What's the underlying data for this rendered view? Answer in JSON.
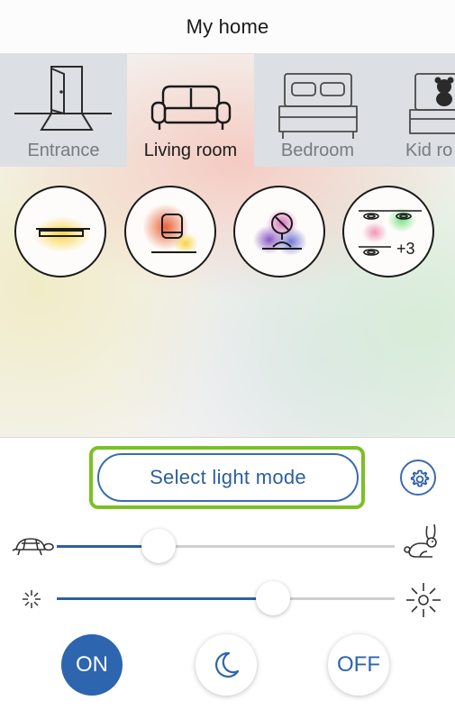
{
  "header": {
    "title": "My home"
  },
  "rooms": [
    {
      "label": "Entrance",
      "icon": "door-icon",
      "active": false
    },
    {
      "label": "Living room",
      "icon": "sofa-icon",
      "active": true
    },
    {
      "label": "Bedroom",
      "icon": "bed-icon",
      "active": false
    },
    {
      "label": "Kid ro",
      "icon": "kid-bed-icon",
      "active": false
    }
  ],
  "lamps": [
    {
      "icon": "ceiling-bar-light-icon",
      "glow": "#f5cf3a"
    },
    {
      "icon": "table-lamp-icon",
      "glow": "#e8623a"
    },
    {
      "icon": "desk-lamp-icon",
      "glow": "#8a55c2"
    },
    {
      "icon": "spotlight-group-icon",
      "extra": "+3"
    }
  ],
  "controls": {
    "mode_button_label": "Select light mode",
    "speed_slider": {
      "min_icon": "turtle-icon",
      "max_icon": "rabbit-icon",
      "value": 0.3
    },
    "brightness_slider": {
      "min_icon": "dim-sun-icon",
      "max_icon": "bright-sun-icon",
      "value": 0.64
    },
    "on_label": "ON",
    "off_label": "OFF",
    "night_icon": "moon-icon"
  },
  "colors": {
    "accent": "#2d65ae",
    "highlight": "#7bc025"
  }
}
